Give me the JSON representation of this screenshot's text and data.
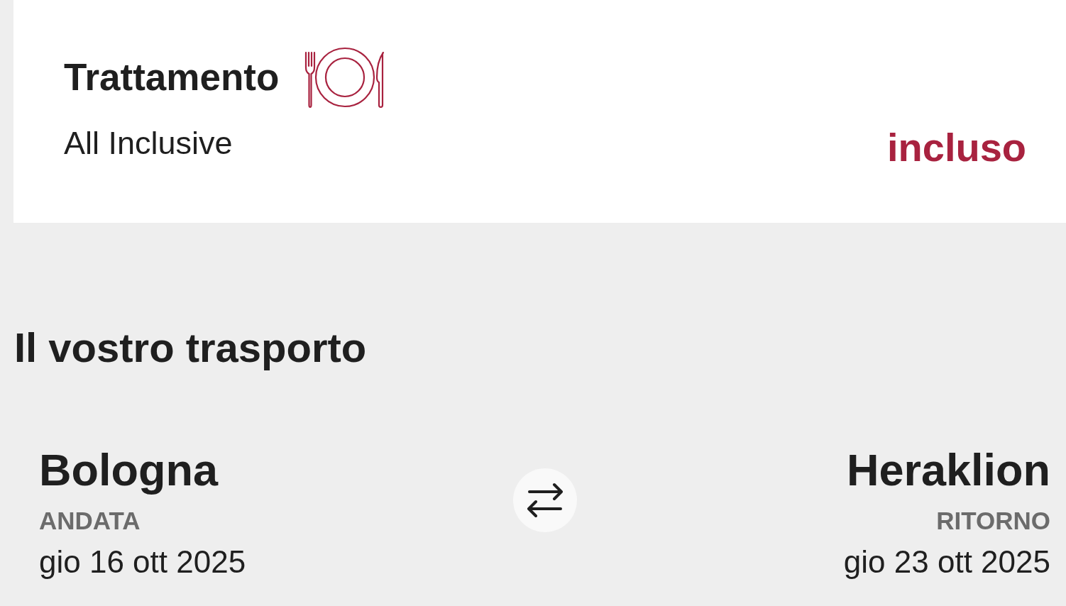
{
  "meal_plan": {
    "title": "Trattamento",
    "value": "All Inclusive",
    "price": "incluso"
  },
  "transport": {
    "title": "Il vostro trasporto",
    "legs": [
      {
        "city": "Bologna",
        "label": "ANDATA",
        "date": "gio 16 ott 2025"
      },
      {
        "city": "Heraklion",
        "label": "RITORNO",
        "date": "gio 23 ott 2025"
      }
    ]
  }
}
